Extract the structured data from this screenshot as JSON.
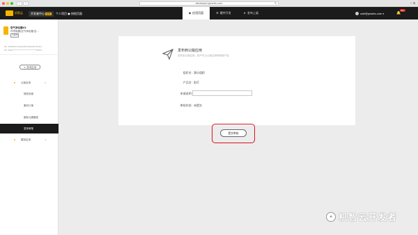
{
  "browser": {
    "url": "developer.gizwits.com",
    "back_icon": "chevron-left-icon",
    "forward_icon": "chevron-right-icon"
  },
  "topnav": {
    "logo": "机智云",
    "dev_center": "开发者中心",
    "dev_badge": "新版",
    "project": "个人项目 ● 授权页面",
    "tabs": [
      {
        "icon": "diamond-icon",
        "label": "应用页面",
        "active": true
      },
      {
        "icon": "gear-icon",
        "label": "硬件开发",
        "active": false
      },
      {
        "icon": "send-icon",
        "label": "发布上架",
        "active": false
      }
    ],
    "user": "sole@gizwits.com ▾",
    "notif_count": "99+"
  },
  "sidebar": {
    "product": {
      "name": "空气净化器V2",
      "category": "环境电器/空气净化器/空...",
      "tag": "已发布"
    },
    "pk": "PK: 8f4fe9fcd4e64d07b6de6f70b2d...",
    "ps": "PS: 8a97**********************9b64",
    "close_button": "× 关闭应用",
    "menu": [
      {
        "label": "公版应用",
        "type": "group",
        "chevron": "∨"
      },
      {
        "label": "授权页面",
        "type": "sub"
      },
      {
        "label": "素材订单",
        "type": "sub"
      },
      {
        "label": "图标元素模型",
        "type": "sub"
      },
      {
        "label": "发布审核",
        "type": "sub",
        "active": true
      },
      {
        "label": "模拟应用",
        "type": "group",
        "chevron": "∨"
      }
    ]
  },
  "main": {
    "title": "发布到公版应用",
    "subtitle": "发布到公版应用，用户可以公版应用审核使产品",
    "fields": [
      {
        "label": "组织名:",
        "value": "演示组织"
      },
      {
        "label": "产品名:",
        "value": "彩灯"
      },
      {
        "label": "申请说明:",
        "value": ""
      },
      {
        "label": "审核状态:",
        "value": "未提交"
      }
    ],
    "submit_label": "提交审核"
  },
  "watermark": {
    "text": "机智云开发者"
  }
}
